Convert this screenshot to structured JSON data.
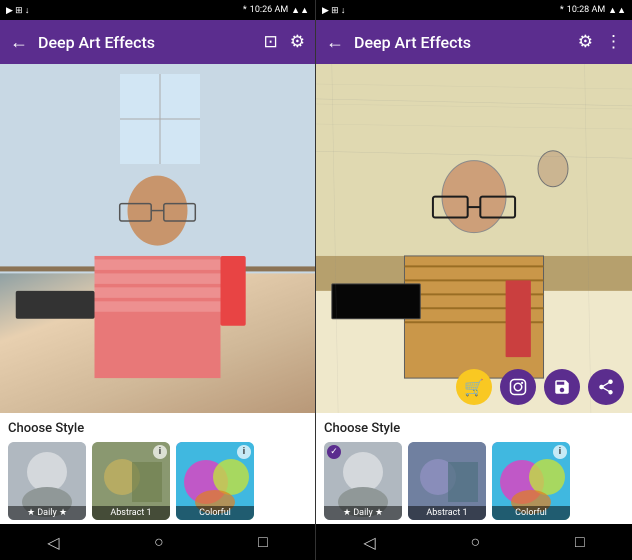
{
  "left_panel": {
    "status_bar": {
      "time": "10:26 AM",
      "icons": [
        "bluetooth",
        "wifi",
        "hd",
        "signal",
        "battery"
      ]
    },
    "header": {
      "title": "Deep Art Effects",
      "back_label": "←",
      "crop_icon": "⊡",
      "settings_icon": "⚙"
    },
    "bottom": {
      "choose_style_label": "Choose Style",
      "styles": [
        {
          "label": "★ Daily ★",
          "type": "daily",
          "has_info": false
        },
        {
          "label": "Abstract 1",
          "type": "abstract",
          "has_info": true
        },
        {
          "label": "Colorful",
          "type": "colorful",
          "has_info": true
        }
      ]
    },
    "nav": {
      "back": "◁",
      "home": "○",
      "recent": "□"
    }
  },
  "right_panel": {
    "status_bar": {
      "time": "10:28 AM",
      "icons": [
        "bluetooth",
        "wifi",
        "hd",
        "signal",
        "battery"
      ]
    },
    "header": {
      "title": "Deep Art Effects",
      "back_label": "←",
      "settings_icon": "⚙",
      "more_icon": "⋮"
    },
    "fab_buttons": [
      {
        "name": "cart",
        "icon": "🛒",
        "class": "fab-cart"
      },
      {
        "name": "instagram",
        "icon": "📷",
        "class": "fab-insta"
      },
      {
        "name": "save",
        "icon": "💾",
        "class": "fab-save"
      },
      {
        "name": "share",
        "icon": "↗",
        "class": "fab-share"
      }
    ],
    "bottom": {
      "choose_style_label": "Choose Style",
      "styles": [
        {
          "label": "★ Daily ★",
          "type": "daily",
          "has_check": true,
          "has_info": false
        },
        {
          "label": "Abstract 1",
          "type": "abstract-right",
          "has_check": false,
          "has_info": false
        },
        {
          "label": "Colorful",
          "type": "colorful",
          "has_check": false,
          "has_info": true
        }
      ]
    },
    "nav": {
      "back": "◁",
      "home": "○",
      "recent": "□"
    }
  }
}
